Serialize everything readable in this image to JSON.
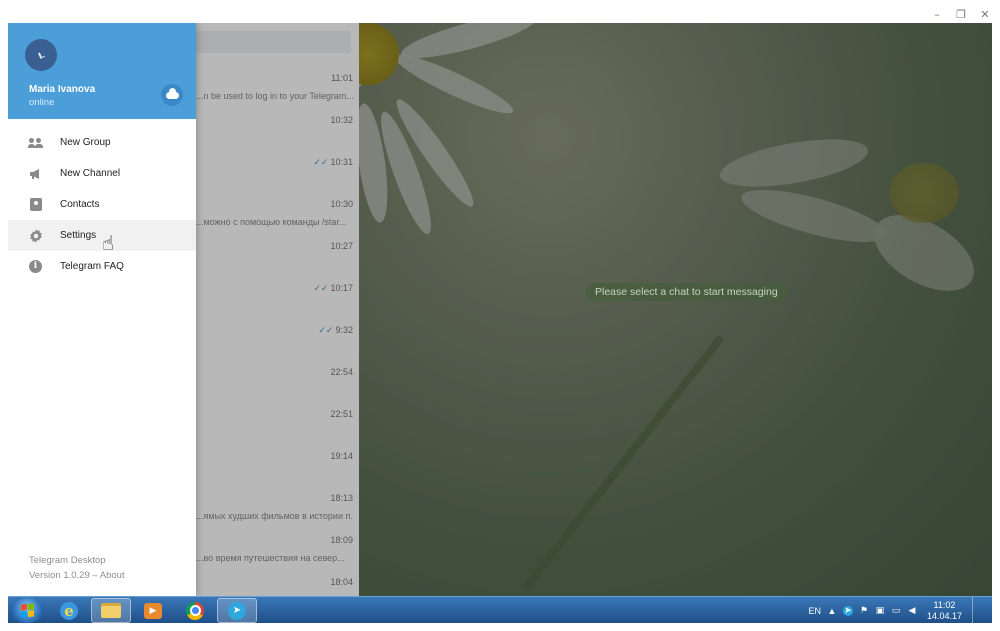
{
  "window": {
    "controls": [
      "minimize-icon",
      "restore-icon",
      "close-icon"
    ],
    "minimize_glyph": "–",
    "restore_glyph": "❐",
    "close_glyph": "✕"
  },
  "drawer": {
    "user": {
      "name": "Maria Ivanova",
      "status": "online"
    },
    "menu": [
      {
        "label": "New Group",
        "icon": "group-icon"
      },
      {
        "label": "New Channel",
        "icon": "megaphone-icon"
      },
      {
        "label": "Contacts",
        "icon": "contact-card-icon"
      },
      {
        "label": "Settings",
        "icon": "gear-icon"
      },
      {
        "label": "Telegram FAQ",
        "icon": "info-icon"
      }
    ],
    "footer": {
      "app_name": "Telegram Desktop",
      "version": "Version 1.0.29 – About"
    }
  },
  "chat_list": {
    "items": [
      {
        "time": "11:01",
        "preview": "...n be used to log in to your Telegram...",
        "read": false
      },
      {
        "time": "10:32",
        "preview": "",
        "read": false
      },
      {
        "time": "10:31",
        "preview": "",
        "read": true
      },
      {
        "time": "10:30",
        "preview": "...можно с помощью команды /star...",
        "read": false
      },
      {
        "time": "10:27",
        "preview": "",
        "read": false
      },
      {
        "time": "10:17",
        "preview": "",
        "read": true
      },
      {
        "time": "9:32",
        "preview": "",
        "read": true
      },
      {
        "time": "22:54",
        "preview": "",
        "read": false
      },
      {
        "time": "22:51",
        "preview": "",
        "read": false
      },
      {
        "time": "19:14",
        "preview": "",
        "read": false
      },
      {
        "time": "18:13",
        "preview": "...ямых худших фильмов в истории п...",
        "read": false
      },
      {
        "time": "18:09",
        "preview": "...во время путешествия на север...",
        "read": false
      },
      {
        "time": "18:04",
        "preview": "",
        "read": false
      }
    ]
  },
  "main": {
    "empty_hint": "Please select a chat to start messaging"
  },
  "taskbar": {
    "apps": [
      "internet-explorer-icon",
      "folder-icon",
      "media-player-icon",
      "chrome-icon",
      "telegram-icon"
    ],
    "active_app": "telegram-icon",
    "language": "EN",
    "tray_up_glyph": "▲",
    "time": "11:02",
    "date": "14.04.17"
  },
  "colors": {
    "header_blue": "#4c9ed9",
    "taskbar_blue": "#2a62a0",
    "accent": "#2ea6de"
  }
}
